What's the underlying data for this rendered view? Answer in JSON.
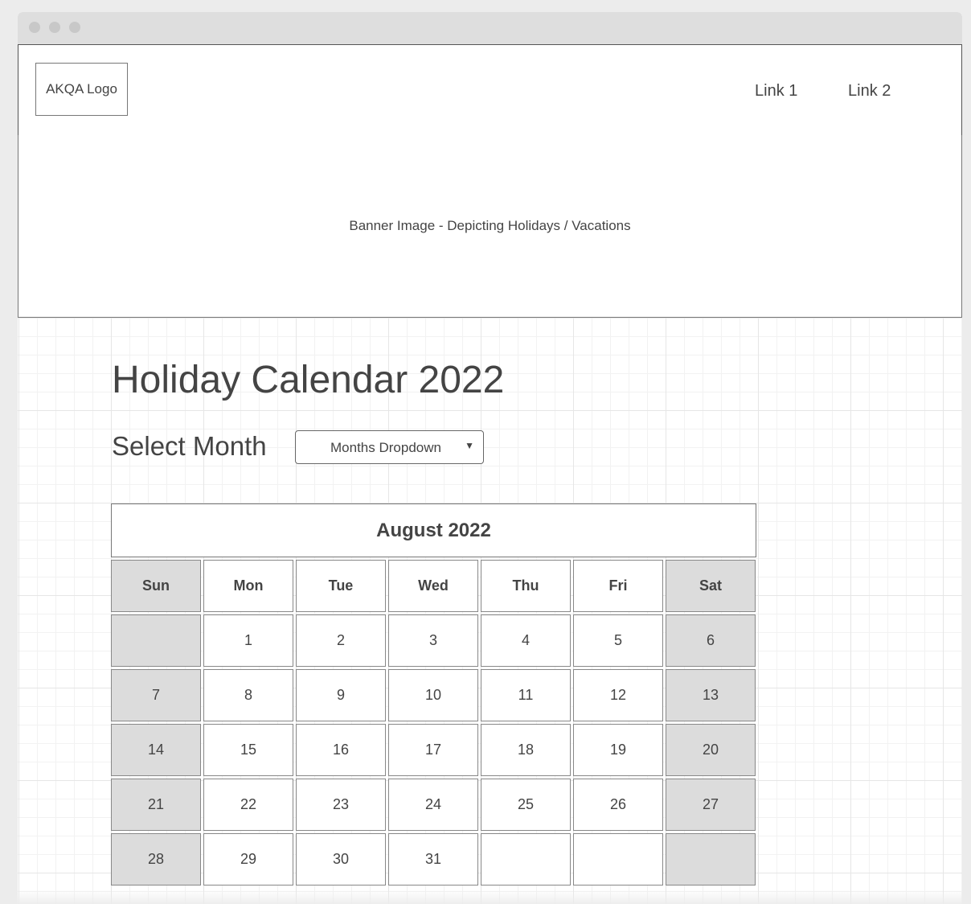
{
  "header": {
    "logo_text": "AKQA Logo",
    "links": [
      "Link 1",
      "Link 2"
    ]
  },
  "banner": {
    "text": "Banner Image - Depicting Holidays / Vacations"
  },
  "main": {
    "title": "Holiday Calendar 2022",
    "select_label": "Select Month",
    "dropdown_value": "Months Dropdown",
    "dropdown_caret": "▼"
  },
  "calendar": {
    "month_title": "August 2022",
    "day_names": [
      "Sun",
      "Mon",
      "Tue",
      "Wed",
      "Thu",
      "Fri",
      "Sat"
    ],
    "weeks": [
      [
        "",
        "1",
        "2",
        "3",
        "4",
        "5",
        "6"
      ],
      [
        "7",
        "8",
        "9",
        "10",
        "11",
        "12",
        "13"
      ],
      [
        "14",
        "15",
        "16",
        "17",
        "18",
        "19",
        "20"
      ],
      [
        "21",
        "22",
        "23",
        "24",
        "25",
        "26",
        "27"
      ],
      [
        "28",
        "29",
        "30",
        "31",
        "",
        "",
        ""
      ]
    ],
    "weekend_color": "#dcdcdc"
  }
}
